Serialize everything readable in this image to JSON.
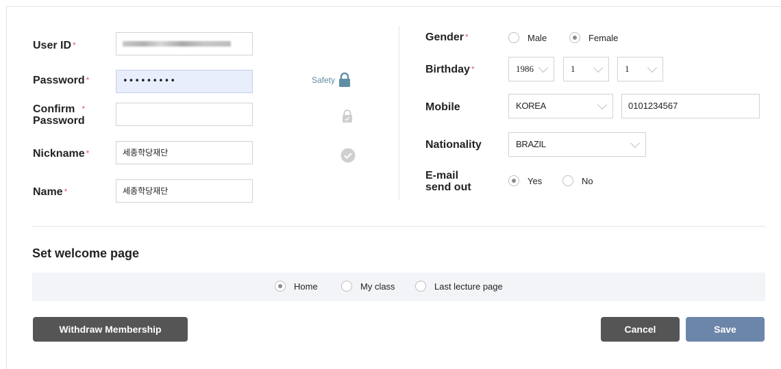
{
  "fields": {
    "user_id_label": "User ID",
    "password_label": "Password",
    "password_value": "•••••••••",
    "confirm_label_line1": "Confirm",
    "confirm_label_line2": "Password",
    "nickname_label": "Nickname",
    "nickname_value": "세종학당재단",
    "name_label": "Name",
    "name_value": "세종학당재단",
    "required_mark": "*"
  },
  "password_strength": {
    "label": "Safety",
    "color": "#5e8ea3"
  },
  "right": {
    "gender_label": "Gender",
    "gender_options": [
      "Male",
      "Female"
    ],
    "gender_selected": "Female",
    "birthday_label": "Birthday",
    "birth_year": "1986",
    "birth_month": "1",
    "birth_day": "1",
    "mobile_label": "Mobile",
    "mobile_country": "KOREA",
    "mobile_number": "0101234567",
    "nationality_label": "Nationality",
    "nationality_value": "BRAZIL",
    "email_label_line1": "E-mail",
    "email_label_line2": "send out",
    "email_options": [
      "Yes",
      "No"
    ],
    "email_selected": "Yes"
  },
  "welcome": {
    "title": "Set welcome page",
    "options": [
      "Home",
      "My class",
      "Last lecture page"
    ],
    "selected": "Home"
  },
  "buttons": {
    "withdraw": "Withdraw Membership",
    "cancel": "Cancel",
    "save": "Save"
  },
  "colors": {
    "required": "#e05a63",
    "dark_button": "#555555",
    "save_button": "#6c86a9",
    "password_fill": "#e8eefc"
  }
}
